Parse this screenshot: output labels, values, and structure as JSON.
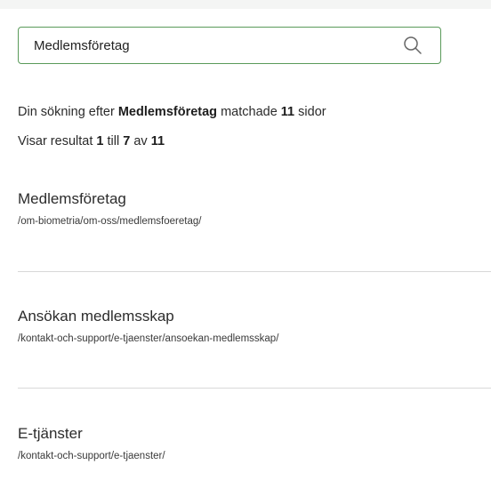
{
  "search": {
    "value": "Medlemsföretag",
    "button_icon": "search-icon"
  },
  "summary": {
    "line1_prefix": "Din sökning efter",
    "query": "Medlemsföretag",
    "line1_middle": "matchade",
    "match_count": "11",
    "line1_suffix": "sidor",
    "line2_prefix": "Visar resultat",
    "from": "1",
    "till_word": "till",
    "to": "7",
    "av_word": "av",
    "total": "11"
  },
  "results": [
    {
      "title": "Medlemsföretag",
      "url": "/om-biometria/om-oss/medlemsfoeretag/"
    },
    {
      "title": "Ansökan medlemsskap",
      "url": "/kontakt-och-support/e-tjaenster/ansoekan-medlemsskap/"
    },
    {
      "title": "E-tjänster",
      "url": "/kontakt-och-support/e-tjaenster/"
    }
  ],
  "colors": {
    "search_border": "#5a9a5a",
    "divider": "#d8d8d8",
    "text": "#222222"
  }
}
